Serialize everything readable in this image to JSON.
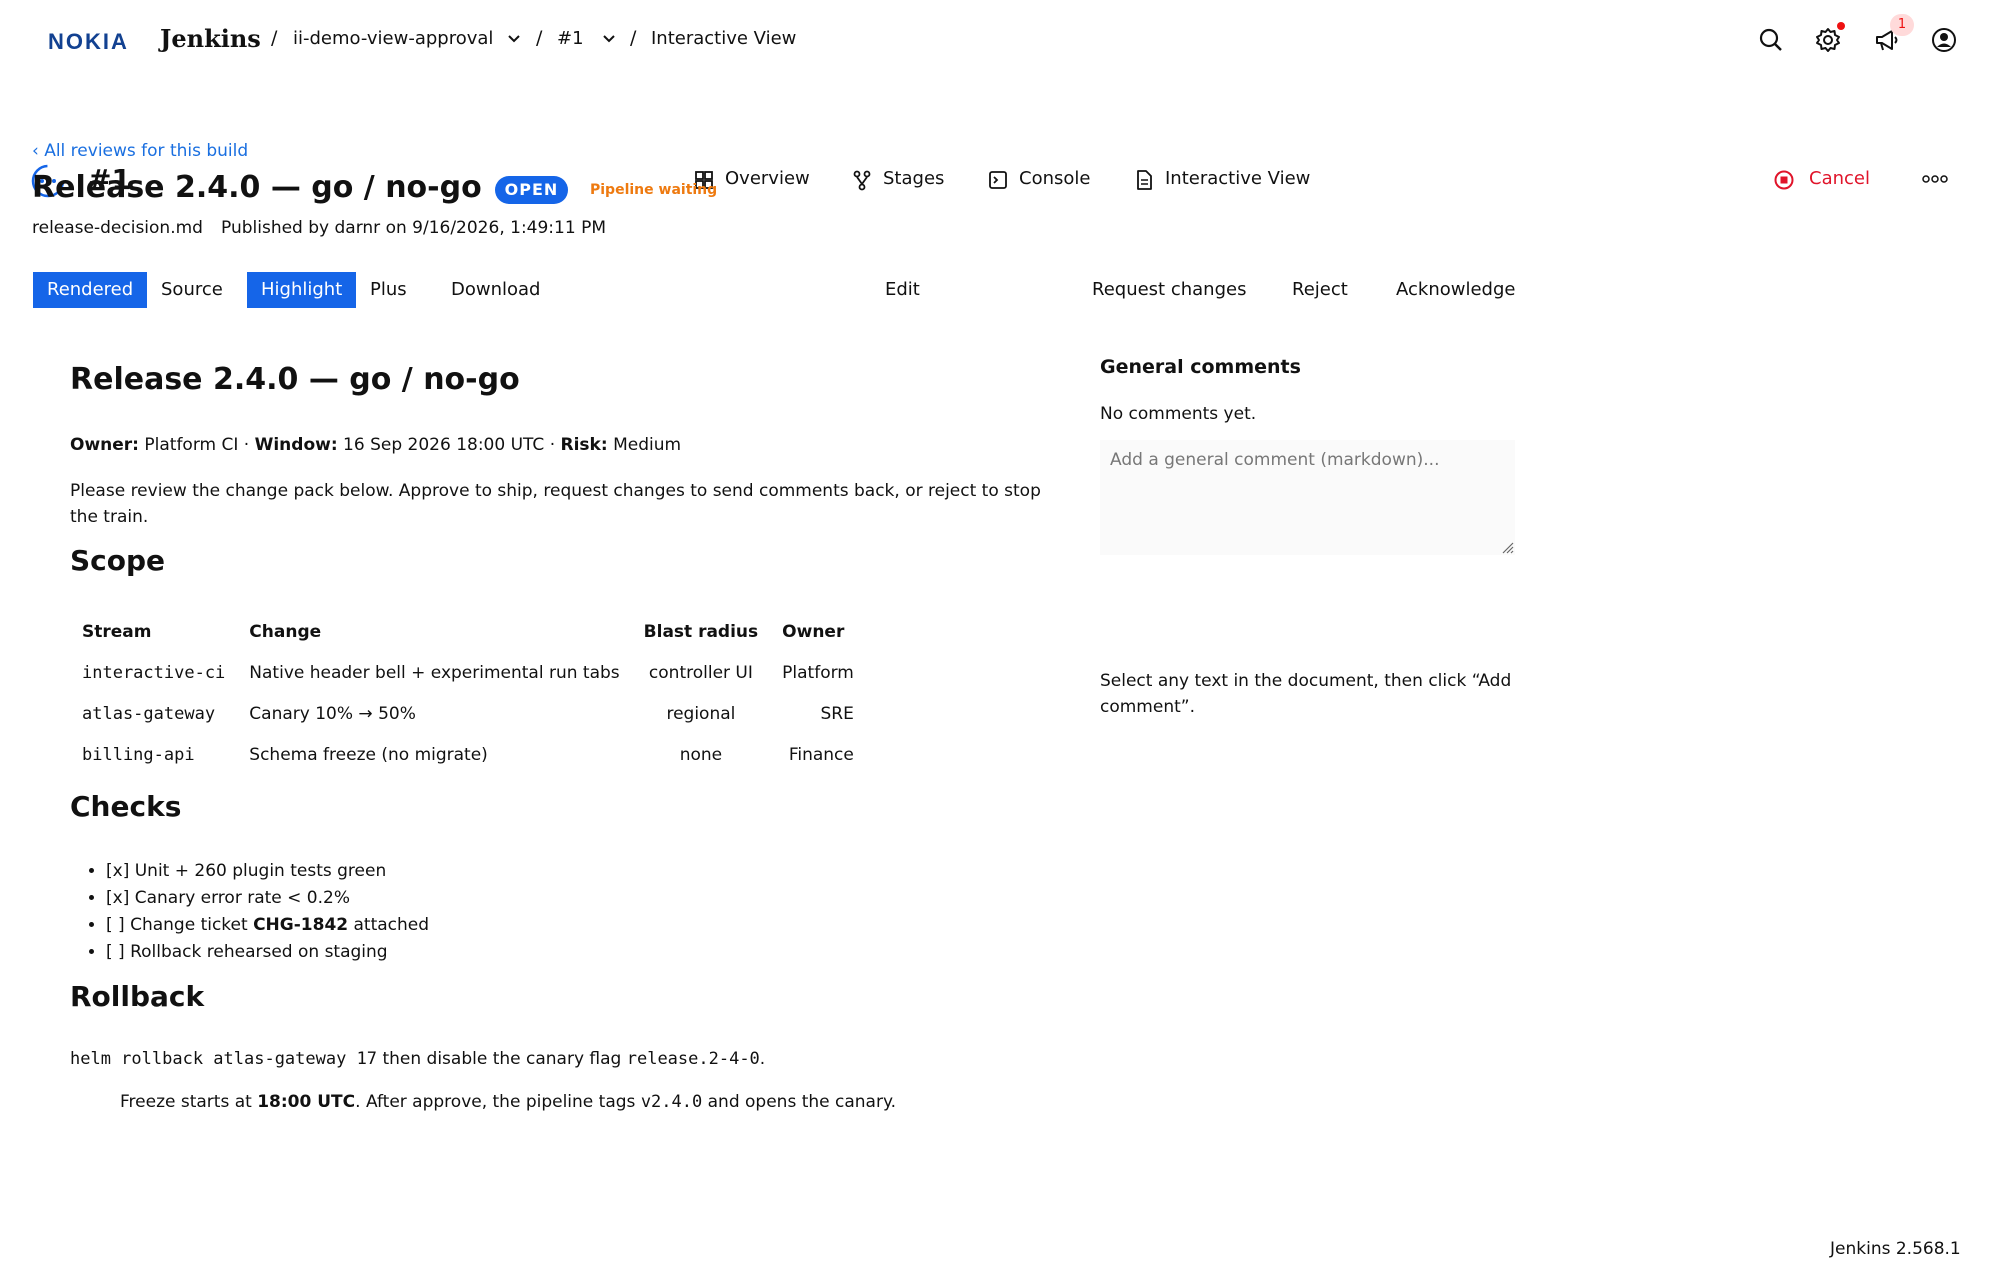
{
  "header": {
    "brand": "NOKIA",
    "app_name": "Jenkins",
    "breadcrumbs": [
      "ii-demo-view-approval",
      "#1",
      "Interactive View"
    ],
    "separator": "/",
    "notification_count": "1"
  },
  "run": {
    "title": "#1",
    "tabs": [
      "Overview",
      "Stages",
      "Console",
      "Interactive View"
    ],
    "cancel_label": "Cancel"
  },
  "review": {
    "back_link": "‹ All reviews for this build",
    "title": "Release 2.4.0 — go / no-go",
    "status_badge": "OPEN",
    "pipeline_status": "Pipeline waiting",
    "filename": "release-decision.md",
    "published": "Published by darnr on 9/16/2026, 1:49:11 PM"
  },
  "toolbar": {
    "view_modes": [
      "Rendered",
      "Source"
    ],
    "highlight_modes": [
      "Highlight",
      "Plus"
    ],
    "download": "Download",
    "edit": "Edit",
    "actions": [
      "Request changes",
      "Reject",
      "Acknowledge"
    ]
  },
  "document": {
    "h1": "Release 2.4.0 — go / no-go",
    "meta": {
      "owner_label": "Owner:",
      "owner": "Platform CI",
      "window_label": "Window:",
      "window": "16 Sep 2026 18:00 UTC",
      "risk_label": "Risk:",
      "risk": "Medium",
      "sep": "·"
    },
    "intro": "Please review the change pack below. Approve to ship, request changes to send comments back, or reject to stop the train.",
    "scope_heading": "Scope",
    "scope_table": {
      "headers": [
        "Stream",
        "Change",
        "Blast radius",
        "Owner"
      ],
      "rows": [
        [
          "interactive-ci",
          "Native header bell + experimental run tabs",
          "controller UI",
          "Platform"
        ],
        [
          "atlas-gateway",
          "Canary 10% → 50%",
          "regional",
          "SRE"
        ],
        [
          "billing-api",
          "Schema freeze (no migrate)",
          "none",
          "Finance"
        ]
      ]
    },
    "checks_heading": "Checks",
    "checks": [
      {
        "text": "[x] Unit + 260 plugin tests green"
      },
      {
        "text": "[x] Canary error rate < 0.2%"
      },
      {
        "pre": "[ ] Change ticket ",
        "bold": "CHG-1842",
        "post": " attached"
      },
      {
        "text": "[ ] Rollback rehearsed on staging"
      }
    ],
    "rollback_heading": "Rollback",
    "rollback_cmd": "helm rollback atlas-gateway 17",
    "rollback_mid": " then disable the canary flag ",
    "rollback_flag": "release.2-4-0",
    "rollback_end": ".",
    "note_pre": "Freeze starts at ",
    "note_bold": "18:00 UTC",
    "note_mid": ". After approve, the pipeline tags ",
    "note_code": "v2.4.0",
    "note_end": " and opens the canary."
  },
  "comments": {
    "title": "General comments",
    "empty": "No comments yet.",
    "placeholder": "Add a general comment (markdown)...",
    "hint": "Select any text in the document, then click “Add comment”."
  },
  "footer": {
    "version": "Jenkins 2.568.1"
  },
  "colors": {
    "accent": "#1565e8",
    "link": "#1a6fe0",
    "danger": "#e0142a",
    "warning": "#ee7a10",
    "logo": "#124191"
  }
}
